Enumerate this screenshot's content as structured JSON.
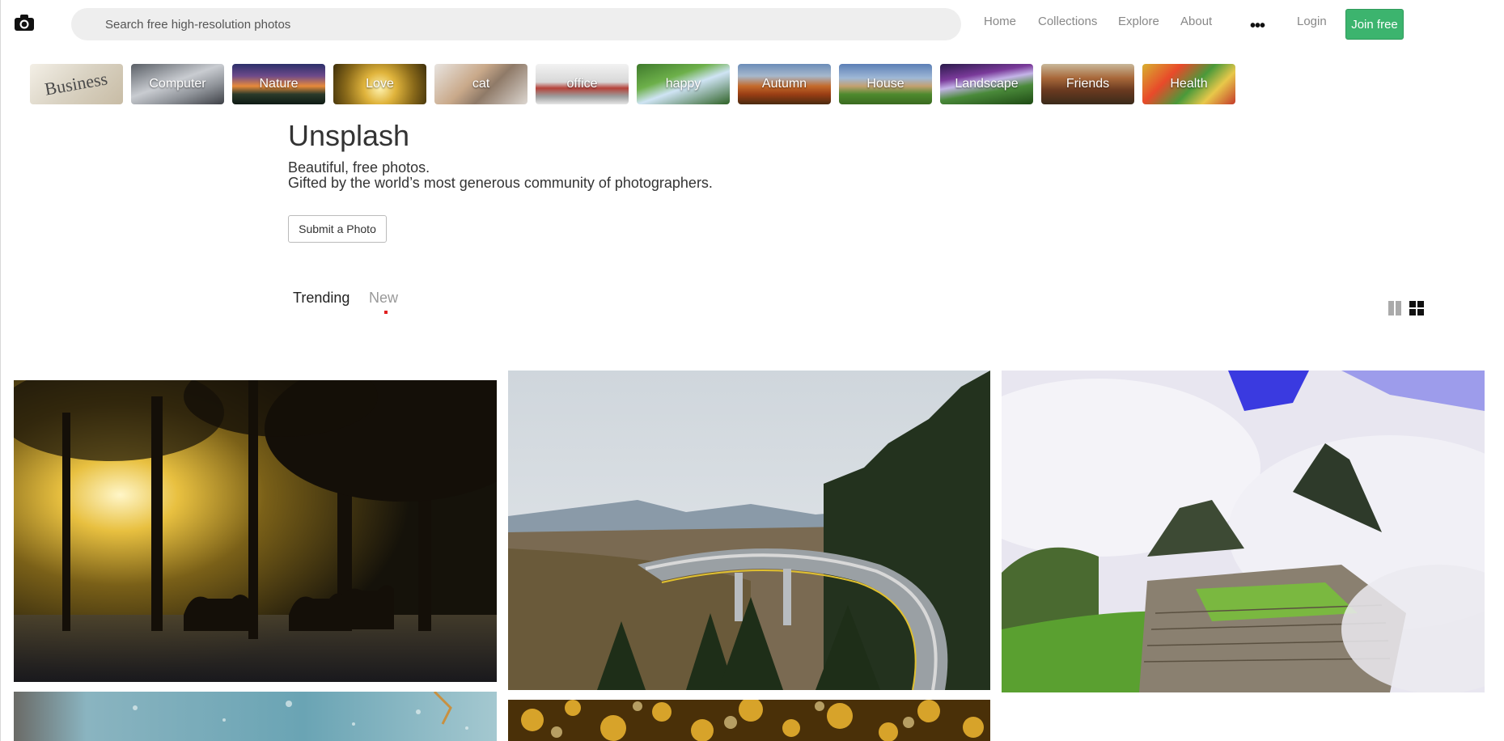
{
  "header": {
    "search_placeholder": "Search free high-resolution photos",
    "nav": [
      "Home",
      "Collections",
      "Explore",
      "About"
    ],
    "more_label": "•••",
    "login_label": "Login",
    "join_label": "Join free",
    "colors": {
      "join": "#3cb46e",
      "nav_text": "#888888"
    }
  },
  "categories": [
    "Business",
    "Computer",
    "Nature",
    "Love",
    "cat",
    "office",
    "happy",
    "Autumn",
    "House",
    "Landscape",
    "Friends",
    "Health"
  ],
  "hero": {
    "title": "Unsplash",
    "subtitle_1": "Beautiful, free photos.",
    "subtitle_2": "Gifted by the world’s most generous community of photographers.",
    "submit_label": "Submit a Photo"
  },
  "tabs": {
    "trending": "Trending",
    "new": "New"
  },
  "view_icons": [
    "single-column-view-icon",
    "grid-view-icon"
  ],
  "photos": [
    "forest-horses-sunlight",
    "mountain-viaduct-road",
    "machu-picchu-clouds",
    "blue-textured-surface",
    "golden-bokeh-lights"
  ]
}
